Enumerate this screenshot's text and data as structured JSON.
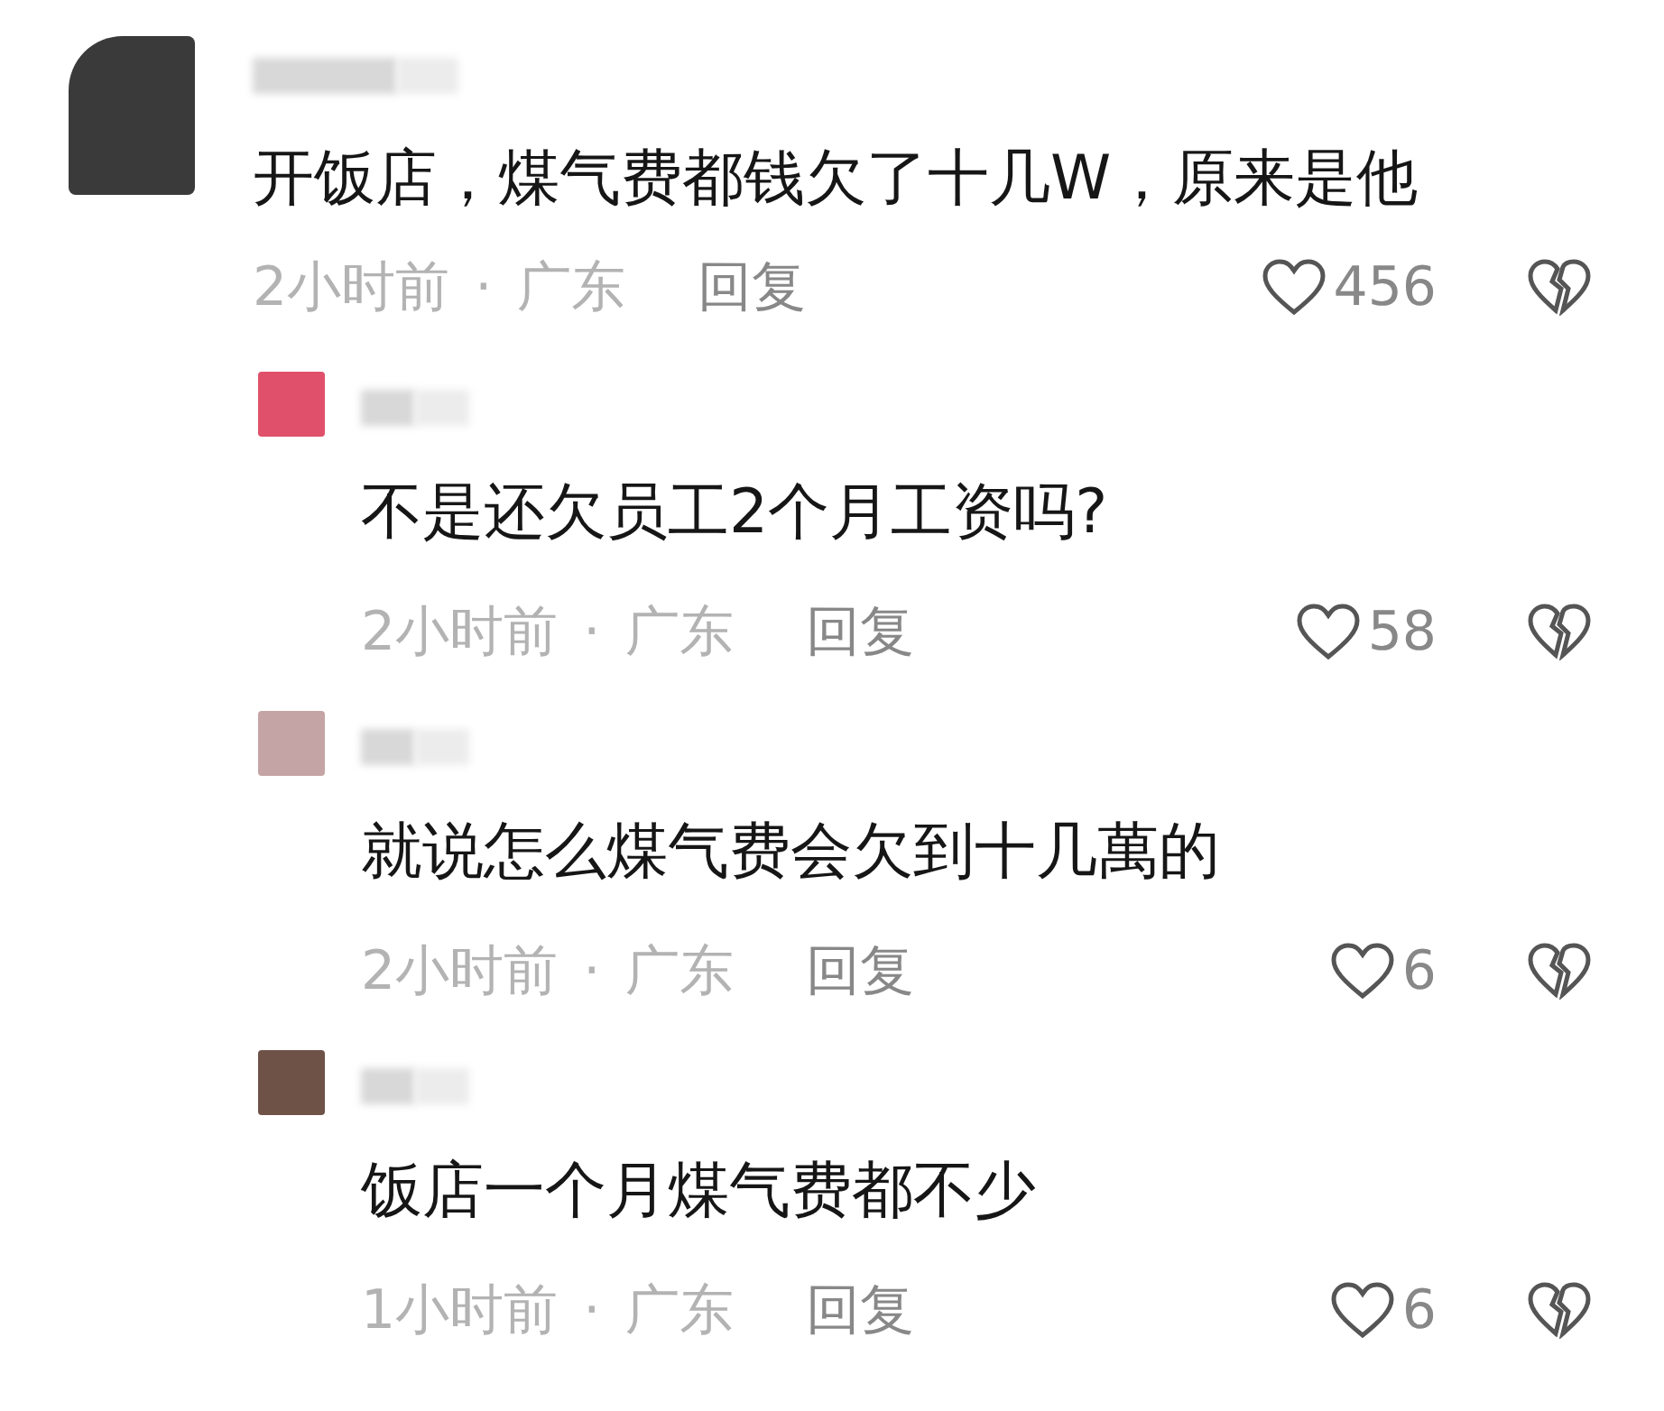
{
  "comments": [
    {
      "text": "开饭店，煤气费都钱欠了十几W，原来是他",
      "time": "2小时前",
      "separator": "·",
      "location": "广东",
      "reply": "回复",
      "likes": "456",
      "color": "#3a3a3a",
      "replies": [
        {
          "text": "不是还欠员工2个月工资吗?",
          "time": "2小时前",
          "separator": "·",
          "location": "广东",
          "reply": "回复",
          "likes": "58",
          "color": "#e0506a"
        },
        {
          "text": "就说怎么煤气费会欠到十几萬的",
          "time": "2小时前",
          "separator": "·",
          "location": "广东",
          "reply": "回复",
          "likes": "6",
          "color": "#c4a4a4"
        },
        {
          "text": "饭店一个月煤气费都不少",
          "time": "1小时前",
          "separator": "·",
          "location": "广东",
          "reply": "回复",
          "likes": "6",
          "color": "#6e5248"
        }
      ]
    }
  ]
}
